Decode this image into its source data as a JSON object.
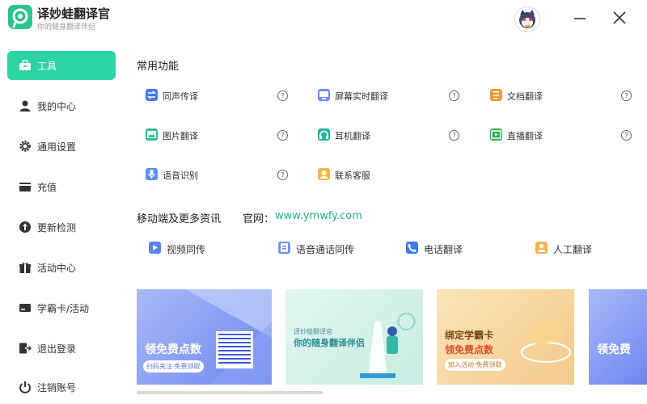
{
  "header": {
    "app_title": "译妙蛙翻译官",
    "app_subtitle": "你的随身翻译伴侣",
    "icons": {
      "logo": "app-logo-icon",
      "avatar": "user-avatar",
      "minimize": "minimize-icon",
      "close": "close-icon"
    }
  },
  "sidebar": {
    "accent_color": "#2cd3a5",
    "items": [
      {
        "label": "工具",
        "icon": "toolbox-icon",
        "active": true
      },
      {
        "label": "我的中心",
        "icon": "user-icon"
      },
      {
        "label": "通用设置",
        "icon": "gear-icon"
      },
      {
        "label": "充值",
        "icon": "wallet-icon"
      },
      {
        "label": "更新检测",
        "icon": "update-icon"
      },
      {
        "label": "活动中心",
        "icon": "gift-icon"
      },
      {
        "label": "学霸卡/活动",
        "icon": "card-icon"
      },
      {
        "label": "退出登录",
        "icon": "logout-icon"
      },
      {
        "label": "注销账号",
        "icon": "power-icon"
      }
    ]
  },
  "common": {
    "title": "常用功能",
    "features": [
      {
        "label": "同声传译",
        "icon": "simultaneous-icon",
        "help": "?"
      },
      {
        "label": "屏幕实时翻译",
        "icon": "screen-icon",
        "help": "?"
      },
      {
        "label": "文档翻译",
        "icon": "document-icon",
        "help": "?"
      },
      {
        "label": "图片翻译",
        "icon": "image-icon",
        "help": "?"
      },
      {
        "label": "耳机翻译",
        "icon": "headphone-icon",
        "help": "?"
      },
      {
        "label": "直播翻译",
        "icon": "live-icon",
        "help": "?"
      },
      {
        "label": "语音识别",
        "icon": "voice-icon",
        "help": "?"
      },
      {
        "label": "联系客服",
        "icon": "service-icon"
      }
    ]
  },
  "mobile": {
    "title": "移动端及更多资讯",
    "site_label": "官网：",
    "site_url": "www.ymwfy.com",
    "items": [
      {
        "label": "视频同传",
        "icon": "video-icon"
      },
      {
        "label": "语音通话同传",
        "icon": "voice-call-icon"
      },
      {
        "label": "电话翻译",
        "icon": "phone-icon"
      },
      {
        "label": "人工翻译",
        "icon": "human-translate-icon"
      }
    ]
  },
  "banners": [
    {
      "headline": "领免费点数",
      "tagline": "扫码关注·免费领取"
    },
    {
      "top": "译妙蛙翻译官",
      "headline": "你的随身翻译伴侣"
    },
    {
      "headline": "绑定学霸卡",
      "sub": "领免费点数",
      "tagline": "加入活动·免费领取"
    },
    {
      "headline": "领免费"
    }
  ]
}
